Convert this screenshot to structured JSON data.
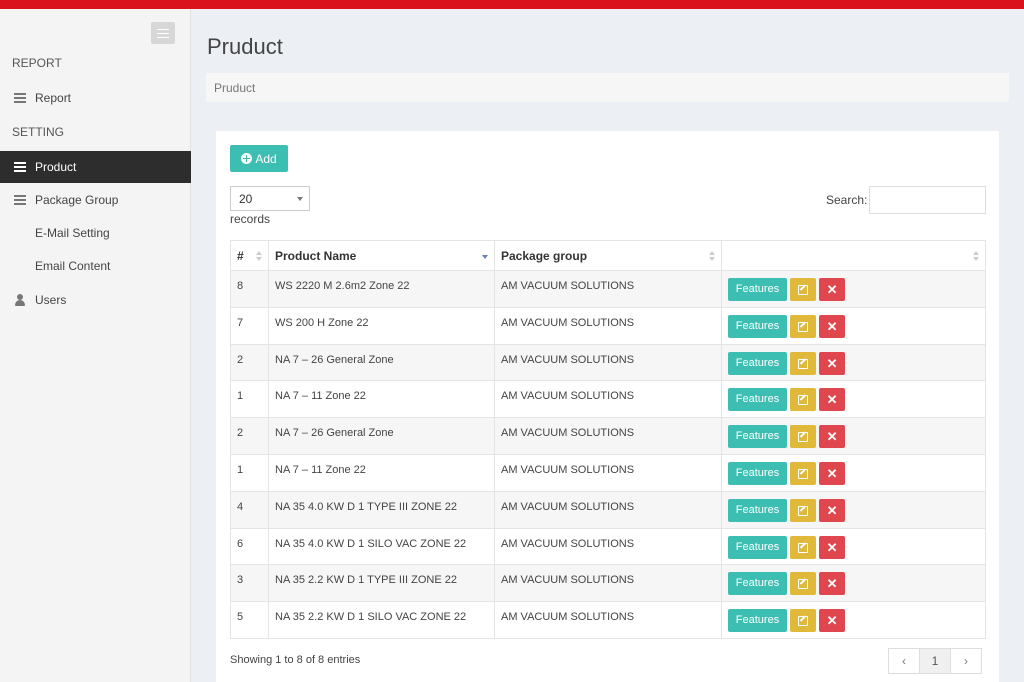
{
  "sidebar": {
    "sections": [
      {
        "label": "REPORT"
      },
      {
        "label": "SETTING"
      }
    ],
    "items": [
      {
        "label": "Report",
        "icon": "list-icon"
      },
      {
        "label": "Product",
        "icon": "list-icon"
      },
      {
        "label": "Package Group",
        "icon": "list-icon"
      },
      {
        "label": "E-Mail Setting"
      },
      {
        "label": "Email Content"
      },
      {
        "label": "Users",
        "icon": "user-icon"
      }
    ],
    "active": "Product"
  },
  "header": {
    "title": "Pruduct",
    "breadcrumb": "Pruduct"
  },
  "toolbar": {
    "add_label": "Add"
  },
  "length": {
    "value": "20",
    "suffix": "records"
  },
  "search": {
    "label": "Search:",
    "value": ""
  },
  "table": {
    "columns": [
      "#",
      "Product Name",
      "Package group",
      ""
    ],
    "sorted_column": "Product Name",
    "rows": [
      {
        "num": "8",
        "name": "WS 2220 M 2.6m2 Zone 22",
        "group": "AM VACUUM SOLUTIONS"
      },
      {
        "num": "7",
        "name": "WS 200 H Zone 22",
        "group": "AM VACUUM SOLUTIONS"
      },
      {
        "num": "2",
        "name": "NA 7 – 26 General Zone",
        "group": "AM VACUUM SOLUTIONS"
      },
      {
        "num": "1",
        "name": "NA 7 – 11 Zone 22",
        "group": "AM VACUUM SOLUTIONS"
      },
      {
        "num": "2",
        "name": "NA 7 – 26 General Zone",
        "group": "AM VACUUM SOLUTIONS"
      },
      {
        "num": "1",
        "name": "NA 7 – 11 Zone 22",
        "group": "AM VACUUM SOLUTIONS"
      },
      {
        "num": "4",
        "name": "NA 35 4.0 KW D 1 TYPE III ZONE 22",
        "group": "AM VACUUM SOLUTIONS"
      },
      {
        "num": "6",
        "name": "NA 35 4.0 KW D 1 SILO VAC ZONE 22",
        "group": "AM VACUUM SOLUTIONS"
      },
      {
        "num": "3",
        "name": "NA 35 2.2 KW D 1 TYPE III ZONE 22",
        "group": "AM VACUUM SOLUTIONS"
      },
      {
        "num": "5",
        "name": "NA 35 2.2 KW D 1 SILO VAC ZONE 22",
        "group": "AM VACUUM SOLUTIONS"
      }
    ],
    "features_label": "Features",
    "delete_glyph": "✕"
  },
  "footer": {
    "info": "Showing 1 to 8 of 8 entries",
    "prev": "‹",
    "page": "1",
    "next": "›"
  },
  "colors": {
    "brand": "#d9121b",
    "accent": "#3cbfb2",
    "edit": "#e0b83a",
    "delete": "#e0464e",
    "sidebar_active": "#2d2d2d"
  }
}
